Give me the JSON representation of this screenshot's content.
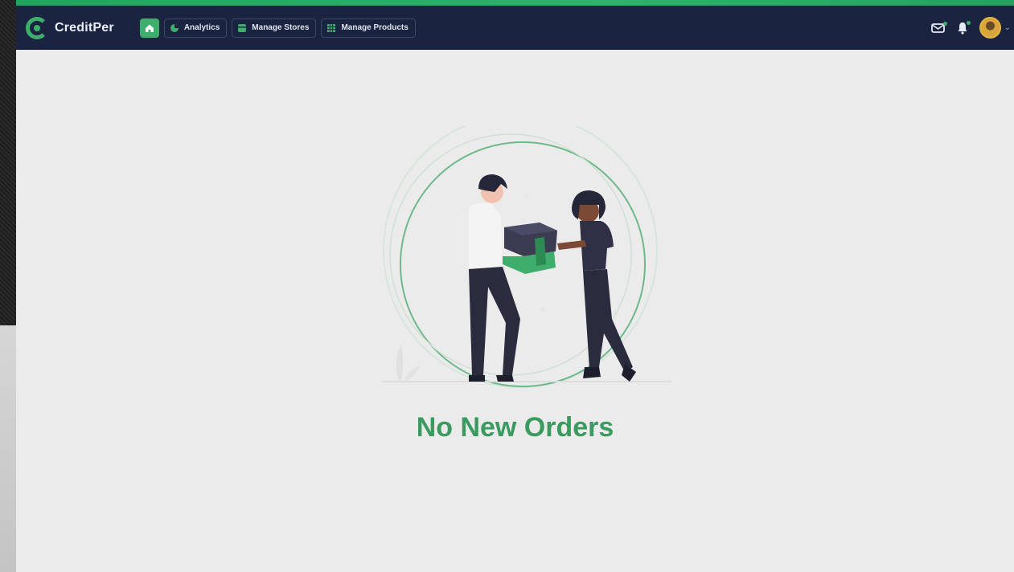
{
  "brand": {
    "name": "CreditPer"
  },
  "nav": {
    "home_icon": "home-icon",
    "items": [
      {
        "label": "Analytics",
        "icon": "analytics-icon"
      },
      {
        "label": "Manage Stores",
        "icon": "store-icon"
      },
      {
        "label": "Manage Products",
        "icon": "products-icon"
      }
    ]
  },
  "header_icons": [
    "mail-icon",
    "bell-icon",
    "avatar",
    "chevron-down-icon"
  ],
  "empty_state": {
    "title": "No New Orders",
    "illustration": "handing-over-package-illustration"
  },
  "colors": {
    "accent": "#3fae6d",
    "navbar": "#1a2440",
    "background": "#ebebeb",
    "title": "#3a9a5f"
  }
}
